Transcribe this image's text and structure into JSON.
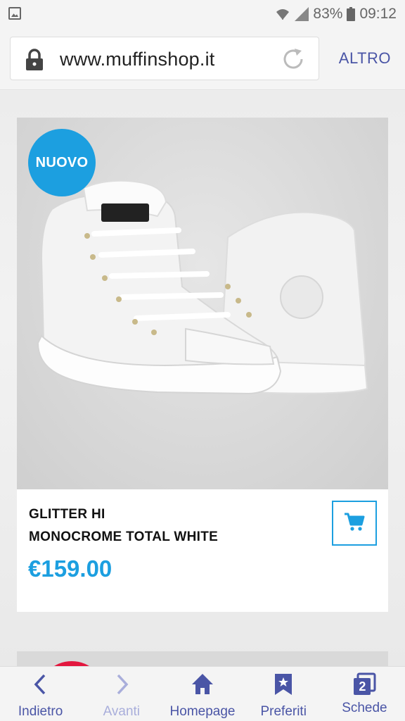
{
  "status_bar": {
    "battery_percent": "83%",
    "time": "09:12",
    "icons": [
      "gallery-icon",
      "wifi-icon",
      "signal-icon",
      "battery-icon"
    ]
  },
  "browser": {
    "url": "www.muffinshop.it",
    "menu_label": "ALTRO",
    "accent_color": "#4a55a6"
  },
  "product": {
    "badge": "NUOVO",
    "name_line1": "GLITTER HI",
    "name_line2": "MONOCROME TOTAL WHITE",
    "price": "€159.00",
    "brand_color": "#1c9fe0",
    "cart_icon": "shopping-cart-icon"
  },
  "bottom_nav": {
    "items": [
      {
        "label": "Indietro",
        "icon": "chevron-left-icon"
      },
      {
        "label": "Avanti",
        "icon": "chevron-right-icon",
        "disabled": true
      },
      {
        "label": "Homepage",
        "icon": "home-icon"
      },
      {
        "label": "Preferiti",
        "icon": "bookmark-star-icon"
      },
      {
        "label": "Schede",
        "icon": "tabs-icon",
        "count": "2"
      }
    ]
  }
}
